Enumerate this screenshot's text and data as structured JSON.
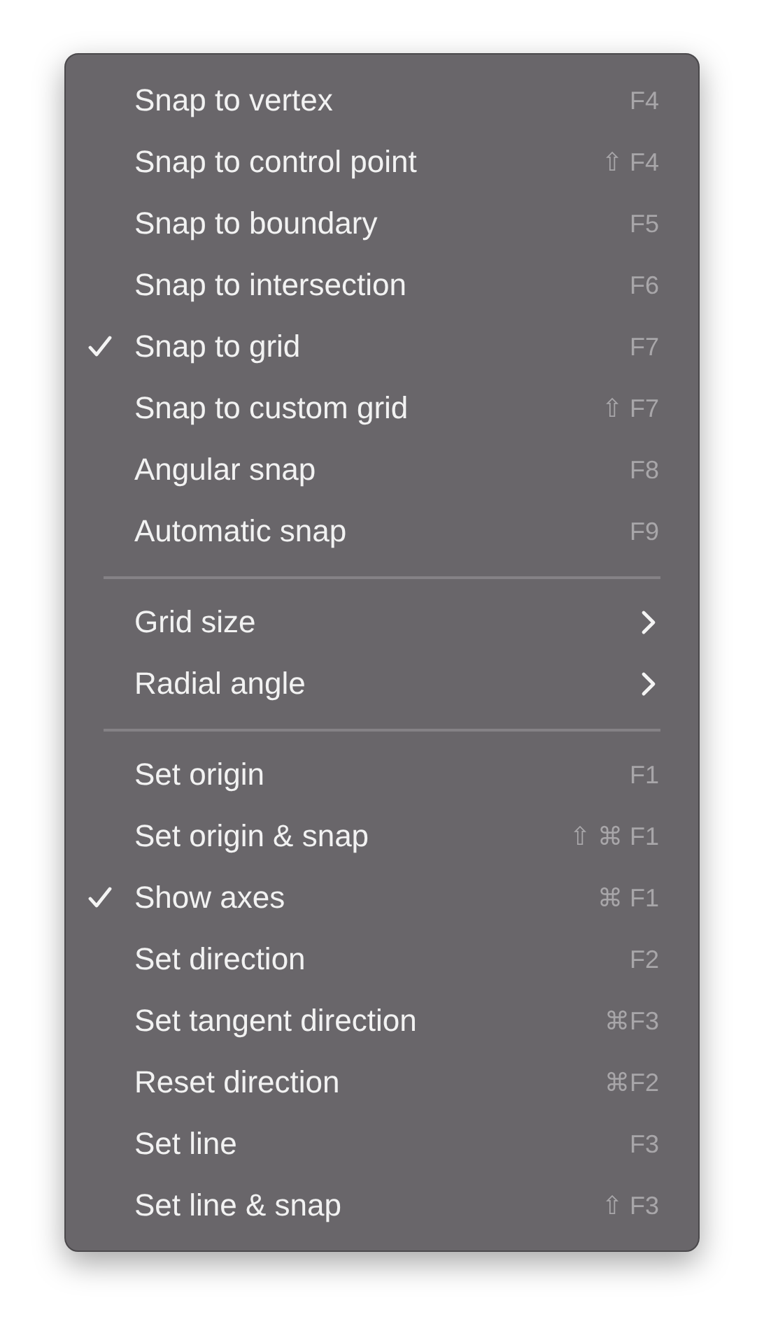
{
  "menu": {
    "sections": [
      {
        "items": [
          {
            "kind": "command",
            "label": "Snap to vertex",
            "shortcut": "F4",
            "checked": false
          },
          {
            "kind": "command",
            "label": "Snap to control point",
            "shortcut": "⇧ F4",
            "checked": false
          },
          {
            "kind": "command",
            "label": "Snap to boundary",
            "shortcut": "F5",
            "checked": false
          },
          {
            "kind": "command",
            "label": "Snap to intersection",
            "shortcut": "F6",
            "checked": false
          },
          {
            "kind": "command",
            "label": "Snap to grid",
            "shortcut": "F7",
            "checked": true
          },
          {
            "kind": "command",
            "label": "Snap to custom grid",
            "shortcut": "⇧ F7",
            "checked": false
          },
          {
            "kind": "command",
            "label": "Angular snap",
            "shortcut": "F8",
            "checked": false
          },
          {
            "kind": "command",
            "label": "Automatic snap",
            "shortcut": "F9",
            "checked": false
          }
        ]
      },
      {
        "items": [
          {
            "kind": "submenu",
            "label": "Grid size"
          },
          {
            "kind": "submenu",
            "label": "Radial angle"
          }
        ]
      },
      {
        "items": [
          {
            "kind": "command",
            "label": "Set origin",
            "shortcut": "F1",
            "checked": false
          },
          {
            "kind": "command",
            "label": "Set origin & snap",
            "shortcut": "⇧ ⌘ F1",
            "checked": false
          },
          {
            "kind": "command",
            "label": "Show axes",
            "shortcut": "⌘ F1",
            "checked": true
          },
          {
            "kind": "command",
            "label": "Set direction",
            "shortcut": "F2",
            "checked": false
          },
          {
            "kind": "command",
            "label": "Set tangent direction",
            "shortcut": "⌘F3",
            "checked": false
          },
          {
            "kind": "command",
            "label": "Reset direction",
            "shortcut": "⌘F2",
            "checked": false
          },
          {
            "kind": "command",
            "label": "Set line",
            "shortcut": "F3",
            "checked": false
          },
          {
            "kind": "command",
            "label": "Set line & snap",
            "shortcut": "⇧ F3",
            "checked": false
          }
        ]
      }
    ]
  }
}
